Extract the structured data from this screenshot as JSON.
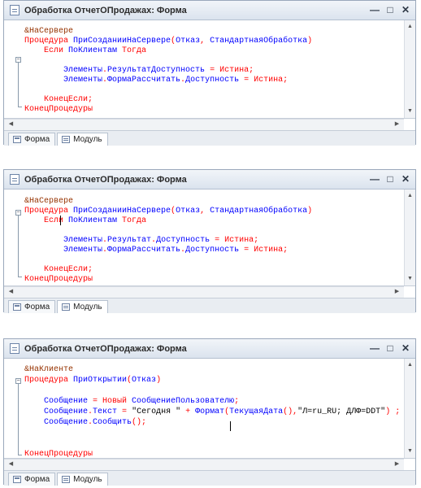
{
  "windows": [
    {
      "title": "Обработка ОтчетОПродажах: Форма",
      "tabs": [
        "Форма",
        "Модуль"
      ],
      "lines": [
        [
          {
            "t": "&НаСервере",
            "c": "pp"
          }
        ],
        [
          {
            "t": "Процедура ",
            "c": "kw"
          },
          {
            "t": "ПриСозданииНаСервере",
            "c": "id"
          },
          {
            "t": "(",
            "c": "kw"
          },
          {
            "t": "Отказ",
            "c": "id"
          },
          {
            "t": ", ",
            "c": "kw"
          },
          {
            "t": "СтандартнаяОбработка",
            "c": "id"
          },
          {
            "t": ")",
            "c": "kw"
          }
        ],
        [
          {
            "t": "    Если ",
            "c": "kw"
          },
          {
            "t": "ПоКлиентам ",
            "c": "id"
          },
          {
            "t": "Тогда",
            "c": "kw"
          }
        ],
        [],
        [
          {
            "t": "        Элементы",
            "c": "id"
          },
          {
            "t": ".",
            "c": "kw"
          },
          {
            "t": "РезультатДоступность",
            "c": "id"
          },
          {
            "t": " = ",
            "c": "kw"
          },
          {
            "t": "Истина",
            "c": "kw"
          },
          {
            "t": ";",
            "c": "kw"
          }
        ],
        [
          {
            "t": "        Элементы",
            "c": "id"
          },
          {
            "t": ".",
            "c": "kw"
          },
          {
            "t": "ФормаРассчитать",
            "c": "id"
          },
          {
            "t": ".",
            "c": "kw"
          },
          {
            "t": "Доступность",
            "c": "id"
          },
          {
            "t": " = ",
            "c": "kw"
          },
          {
            "t": "Истина",
            "c": "kw"
          },
          {
            "t": ";",
            "c": "kw"
          }
        ],
        [],
        [
          {
            "t": "    КонецЕсли;",
            "c": "kw"
          }
        ],
        [
          {
            "t": "КонецПроцедуры",
            "c": "kw"
          }
        ]
      ]
    },
    {
      "title": "Обработка ОтчетОПродажах: Форма",
      "tabs": [
        "Форма",
        "Модуль"
      ],
      "lines": [
        [
          {
            "t": "&НаСервере",
            "c": "pp"
          }
        ],
        [
          {
            "t": "Процедура ",
            "c": "kw"
          },
          {
            "t": "ПриСозданииНаСервере",
            "c": "id"
          },
          {
            "t": "(",
            "c": "kw"
          },
          {
            "t": "Отказ",
            "c": "id"
          },
          {
            "t": ", ",
            "c": "kw"
          },
          {
            "t": "СтандартнаяОбработка",
            "c": "id"
          },
          {
            "t": ")",
            "c": "kw"
          }
        ],
        [
          {
            "t": "    Если ",
            "c": "kw"
          },
          {
            "t": "ПоКлиентам ",
            "c": "id"
          },
          {
            "t": "Тогда",
            "c": "kw"
          }
        ],
        [],
        [
          {
            "t": "        Элементы",
            "c": "id"
          },
          {
            "t": ".",
            "c": "kw"
          },
          {
            "t": "Результат",
            "c": "id"
          },
          {
            "t": ".",
            "c": "kw"
          },
          {
            "t": "Доступность",
            "c": "id"
          },
          {
            "t": " = ",
            "c": "kw"
          },
          {
            "t": "Истина",
            "c": "kw"
          },
          {
            "t": ";",
            "c": "kw"
          }
        ],
        [
          {
            "t": "        Элементы",
            "c": "id"
          },
          {
            "t": ".",
            "c": "kw"
          },
          {
            "t": "ФормаРассчитать",
            "c": "id"
          },
          {
            "t": ".",
            "c": "kw"
          },
          {
            "t": "Доступность",
            "c": "id"
          },
          {
            "t": " = ",
            "c": "kw"
          },
          {
            "t": "Истина",
            "c": "kw"
          },
          {
            "t": ";",
            "c": "kw"
          }
        ],
        [],
        [
          {
            "t": "    КонецЕсли;",
            "c": "kw"
          }
        ],
        [
          {
            "t": "КонецПроцедуры",
            "c": "kw"
          }
        ]
      ]
    },
    {
      "title": "Обработка ОтчетОПродажах: Форма",
      "tabs": [
        "Форма",
        "Модуль"
      ],
      "lines": [
        [
          {
            "t": "&НаКлиенте",
            "c": "pp"
          }
        ],
        [
          {
            "t": "Процедура ",
            "c": "kw"
          },
          {
            "t": "ПриОткрытии",
            "c": "id"
          },
          {
            "t": "(",
            "c": "kw"
          },
          {
            "t": "Отказ",
            "c": "id"
          },
          {
            "t": ")",
            "c": "kw"
          }
        ],
        [],
        [
          {
            "t": "    Сообщение",
            "c": "id"
          },
          {
            "t": " = ",
            "c": "kw"
          },
          {
            "t": "Новый ",
            "c": "kw"
          },
          {
            "t": "СообщениеПользователю",
            "c": "id"
          },
          {
            "t": ";",
            "c": "kw"
          }
        ],
        [
          {
            "t": "    Сообщение",
            "c": "id"
          },
          {
            "t": ".",
            "c": "kw"
          },
          {
            "t": "Текст",
            "c": "id"
          },
          {
            "t": " = ",
            "c": "kw"
          },
          {
            "t": "\"Сегодня \"",
            "c": "st"
          },
          {
            "t": " + ",
            "c": "kw"
          },
          {
            "t": "Формат",
            "c": "id"
          },
          {
            "t": "(",
            "c": "kw"
          },
          {
            "t": "ТекущаяДата",
            "c": "id"
          },
          {
            "t": "(),",
            "c": "kw"
          },
          {
            "t": "\"Л=ru_RU; ДЛФ=DDT\"",
            "c": "st"
          },
          {
            "t": ") ;",
            "c": "kw"
          }
        ],
        [
          {
            "t": "    Сообщение",
            "c": "id"
          },
          {
            "t": ".",
            "c": "kw"
          },
          {
            "t": "Сообщить",
            "c": "id"
          },
          {
            "t": "();",
            "c": "kw"
          }
        ],
        [],
        [],
        [
          {
            "t": "КонецПроцедуры",
            "c": "kw"
          }
        ]
      ]
    }
  ]
}
